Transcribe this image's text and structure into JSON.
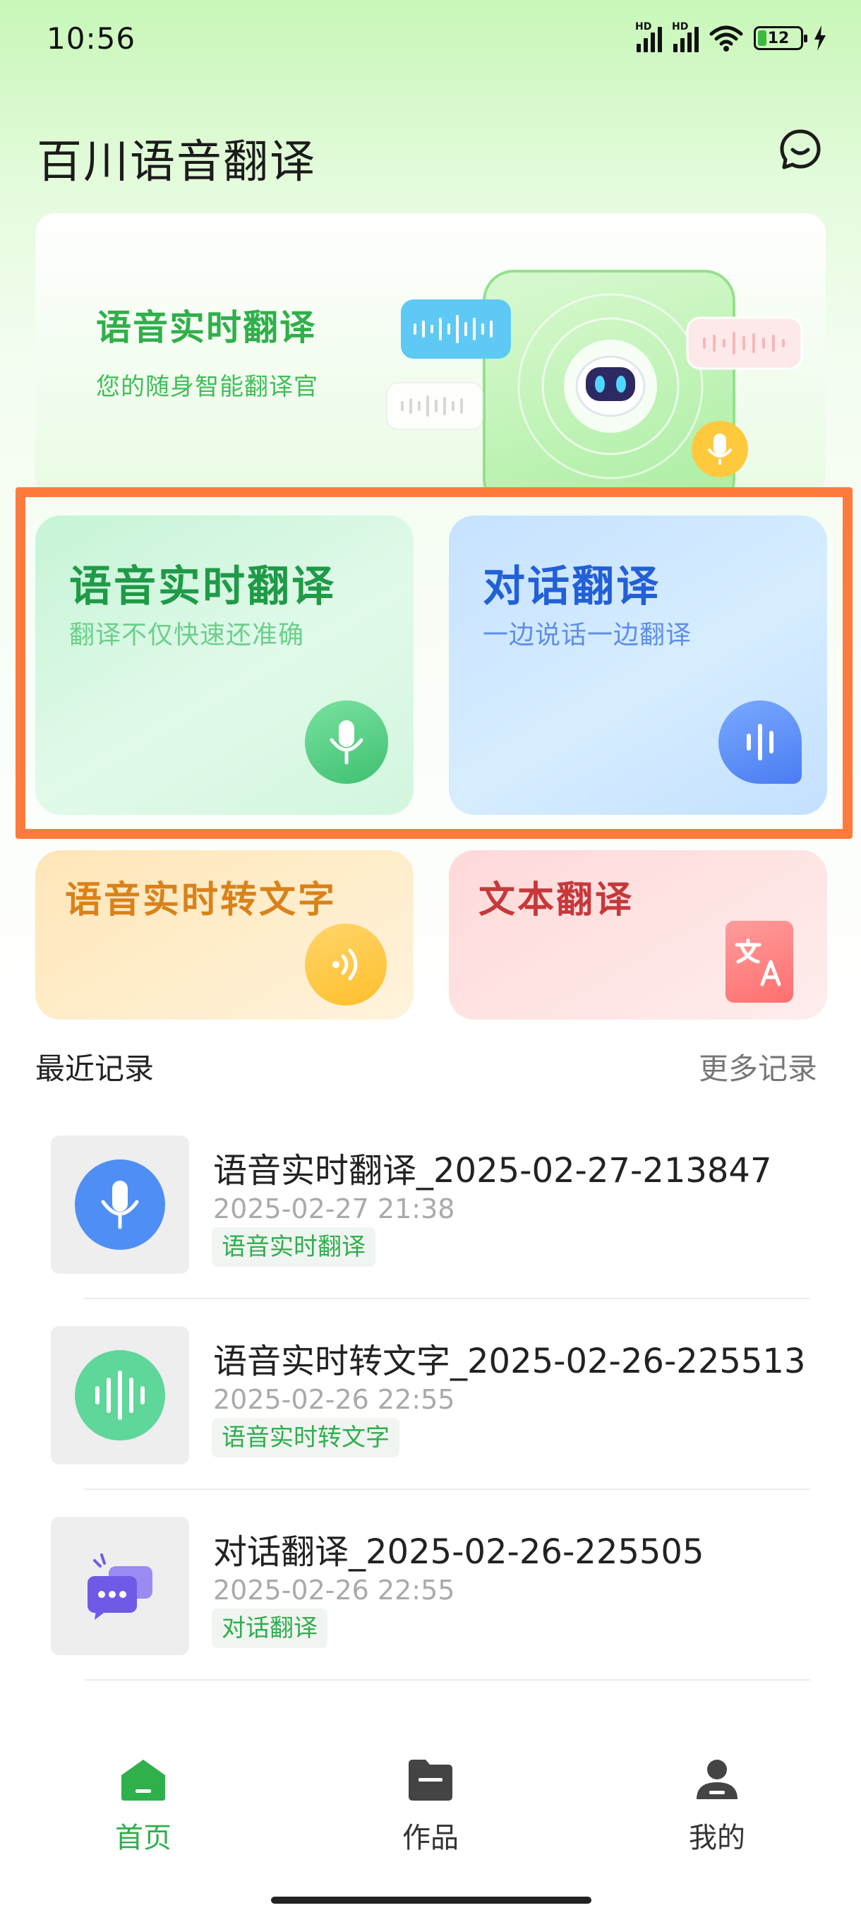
{
  "status_bar": {
    "time": "10:56",
    "battery": "12"
  },
  "header": {
    "title": "百川语音翻译",
    "support_icon": "chat-support-icon"
  },
  "banner": {
    "title": "语音实时翻译",
    "subtitle": "您的随身智能翻译官"
  },
  "features": {
    "voice_realtime": {
      "title": "语音实时翻译",
      "subtitle": "翻译不仅快速还准确",
      "icon": "microphone-icon"
    },
    "dialog": {
      "title": "对话翻译",
      "subtitle": "一边说话一边翻译",
      "icon": "sound-wave-icon"
    },
    "speech_to_text": {
      "title": "语音实时转文字",
      "icon": "audio-waves-icon"
    },
    "text_translate": {
      "title": "文本翻译",
      "icon": "translate-icon"
    }
  },
  "recent": {
    "title": "最近记录",
    "more": "更多记录",
    "items": [
      {
        "name": "语音实时翻译_2025-02-27-213847",
        "time": "2025-02-27 21:38",
        "tag": "语音实时翻译"
      },
      {
        "name": "语音实时转文字_2025-02-26-225513",
        "time": "2025-02-26 22:55",
        "tag": "语音实时转文字"
      },
      {
        "name": "对话翻译_2025-02-26-225505",
        "time": "2025-02-26 22:55",
        "tag": "对话翻译"
      }
    ]
  },
  "nav": {
    "home": "首页",
    "works": "作品",
    "mine": "我的"
  },
  "colors": {
    "accent_green": "#2fb04a",
    "accent_blue": "#2260d6",
    "highlight": "#ff7a3d"
  }
}
